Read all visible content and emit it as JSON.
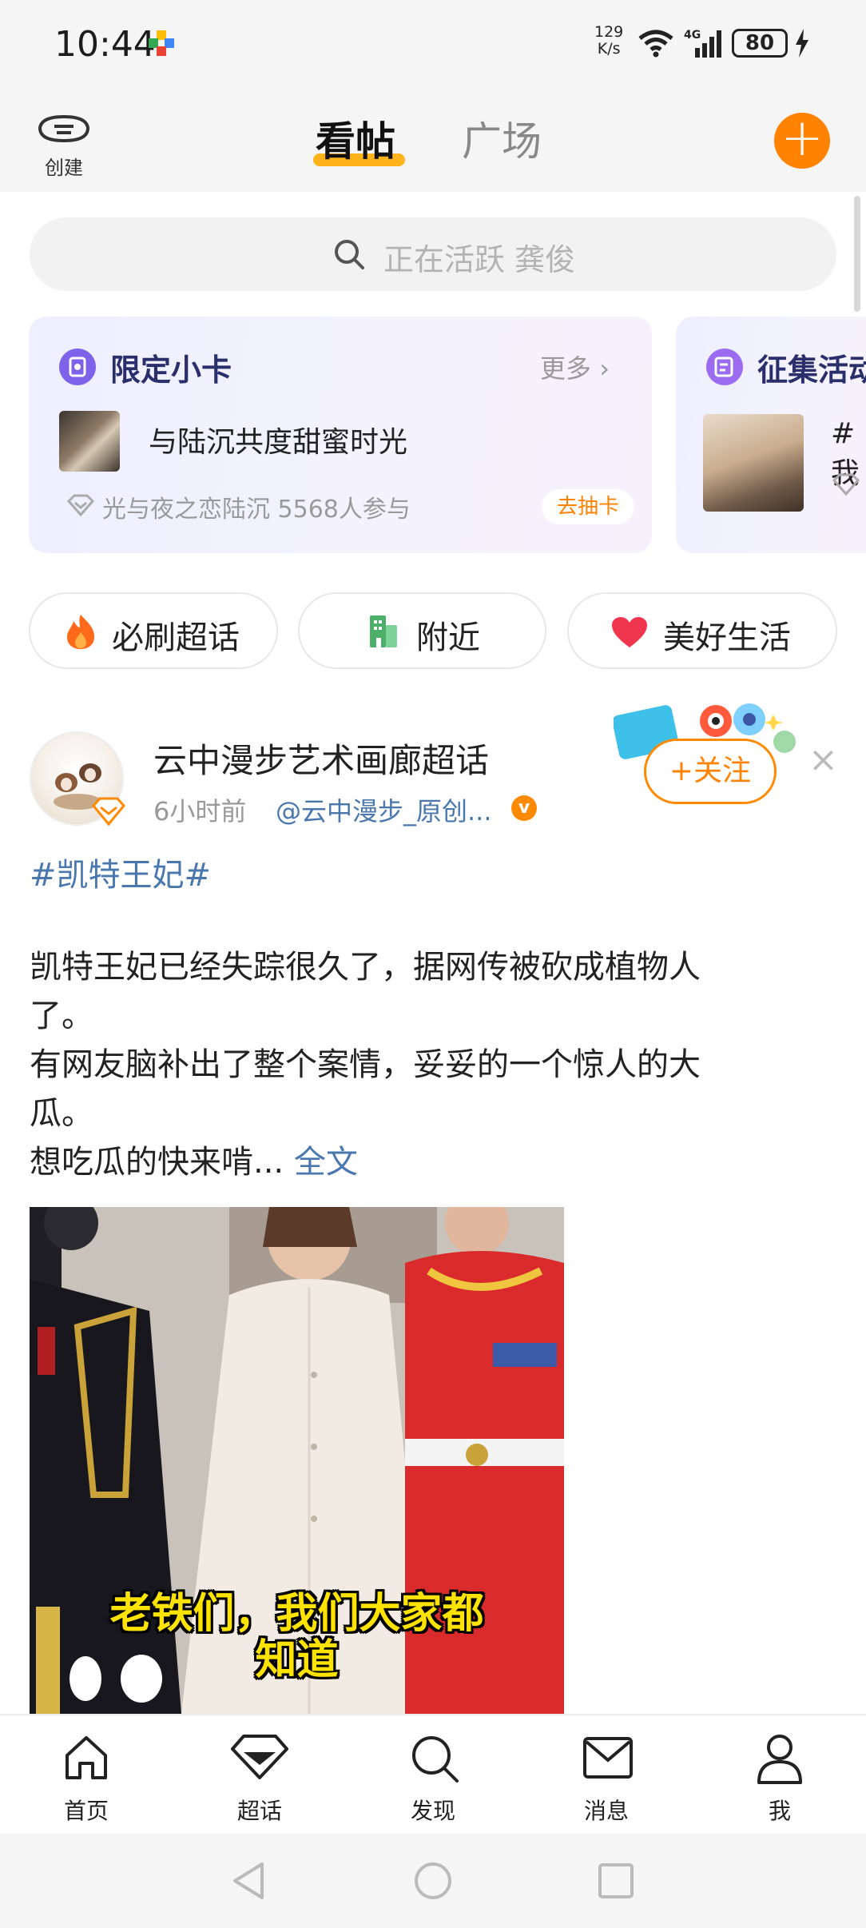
{
  "status_bar": {
    "time": "10:44",
    "net_speed_value": "129",
    "net_speed_unit": "K/s",
    "signal_label": "4G",
    "battery": "80"
  },
  "header": {
    "create_label": "创建",
    "tabs": [
      {
        "label": "看帖",
        "active": true
      },
      {
        "label": "广场",
        "active": false
      }
    ],
    "add_label": "+"
  },
  "search": {
    "placeholder": "正在活跃 龚俊"
  },
  "cards": [
    {
      "title": "限定小卡",
      "more": "更多",
      "item_text": "与陆沉共度甜蜜时光",
      "meta": "光与夜之恋陆沉 5568人参与",
      "action": "去抽卡"
    },
    {
      "title": "征集活动",
      "item_text": "#我"
    }
  ],
  "chips": [
    {
      "label": "必刷超话",
      "icon": "fire-icon"
    },
    {
      "label": "附近",
      "icon": "building-icon"
    },
    {
      "label": "美好生活",
      "icon": "heart-icon"
    }
  ],
  "post": {
    "author": "云中漫步艺术画廊超话",
    "time": "6小时前",
    "source": "@云中漫步_原创...",
    "follow_label": "+关注",
    "close_label": "×",
    "topic": "#凯特王妃#",
    "body_lines": [
      "凯特王妃已经失踪很久了，据网传被砍成植物人",
      "了。",
      "有网友脑补出了整个案情，妥妥的一个惊人的大",
      "瓜。",
      "想吃瓜的快来啃..."
    ],
    "more_label": "全文",
    "image_caption_line1": "老铁们，我们大家都",
    "image_caption_line2": "知道"
  },
  "bottom_nav": [
    {
      "label": "首页",
      "icon": "home-icon"
    },
    {
      "label": "超话",
      "icon": "diamond-icon"
    },
    {
      "label": "发现",
      "icon": "search-icon"
    },
    {
      "label": "消息",
      "icon": "mail-icon"
    },
    {
      "label": "我",
      "icon": "person-icon"
    }
  ],
  "colors": {
    "accent": "#ff8200",
    "link": "#4a77ad",
    "tab_underline": "#ffb31a"
  }
}
